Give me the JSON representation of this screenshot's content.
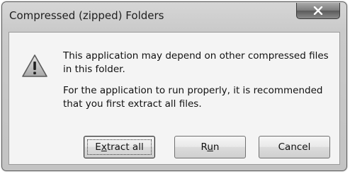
{
  "window": {
    "title": "Compressed (zipped) Folders",
    "close_label": "close"
  },
  "message": {
    "line1": "This application may depend on other compressed files in this folder.",
    "line2": "For the application to run properly, it is recommended that you first extract all files."
  },
  "buttons": {
    "extract_prefix": "E",
    "extract_mnemonic": "x",
    "extract_suffix": "tract all",
    "run_prefix": "R",
    "run_mnemonic": "u",
    "run_suffix": "n",
    "cancel": "Cancel"
  },
  "icons": {
    "warning": "warning-triangle-icon",
    "close": "close-icon"
  },
  "colors": {
    "frame": "#c8c8c8",
    "content_bg": "#f4f4f4",
    "close_button": "#7b7b7b"
  }
}
